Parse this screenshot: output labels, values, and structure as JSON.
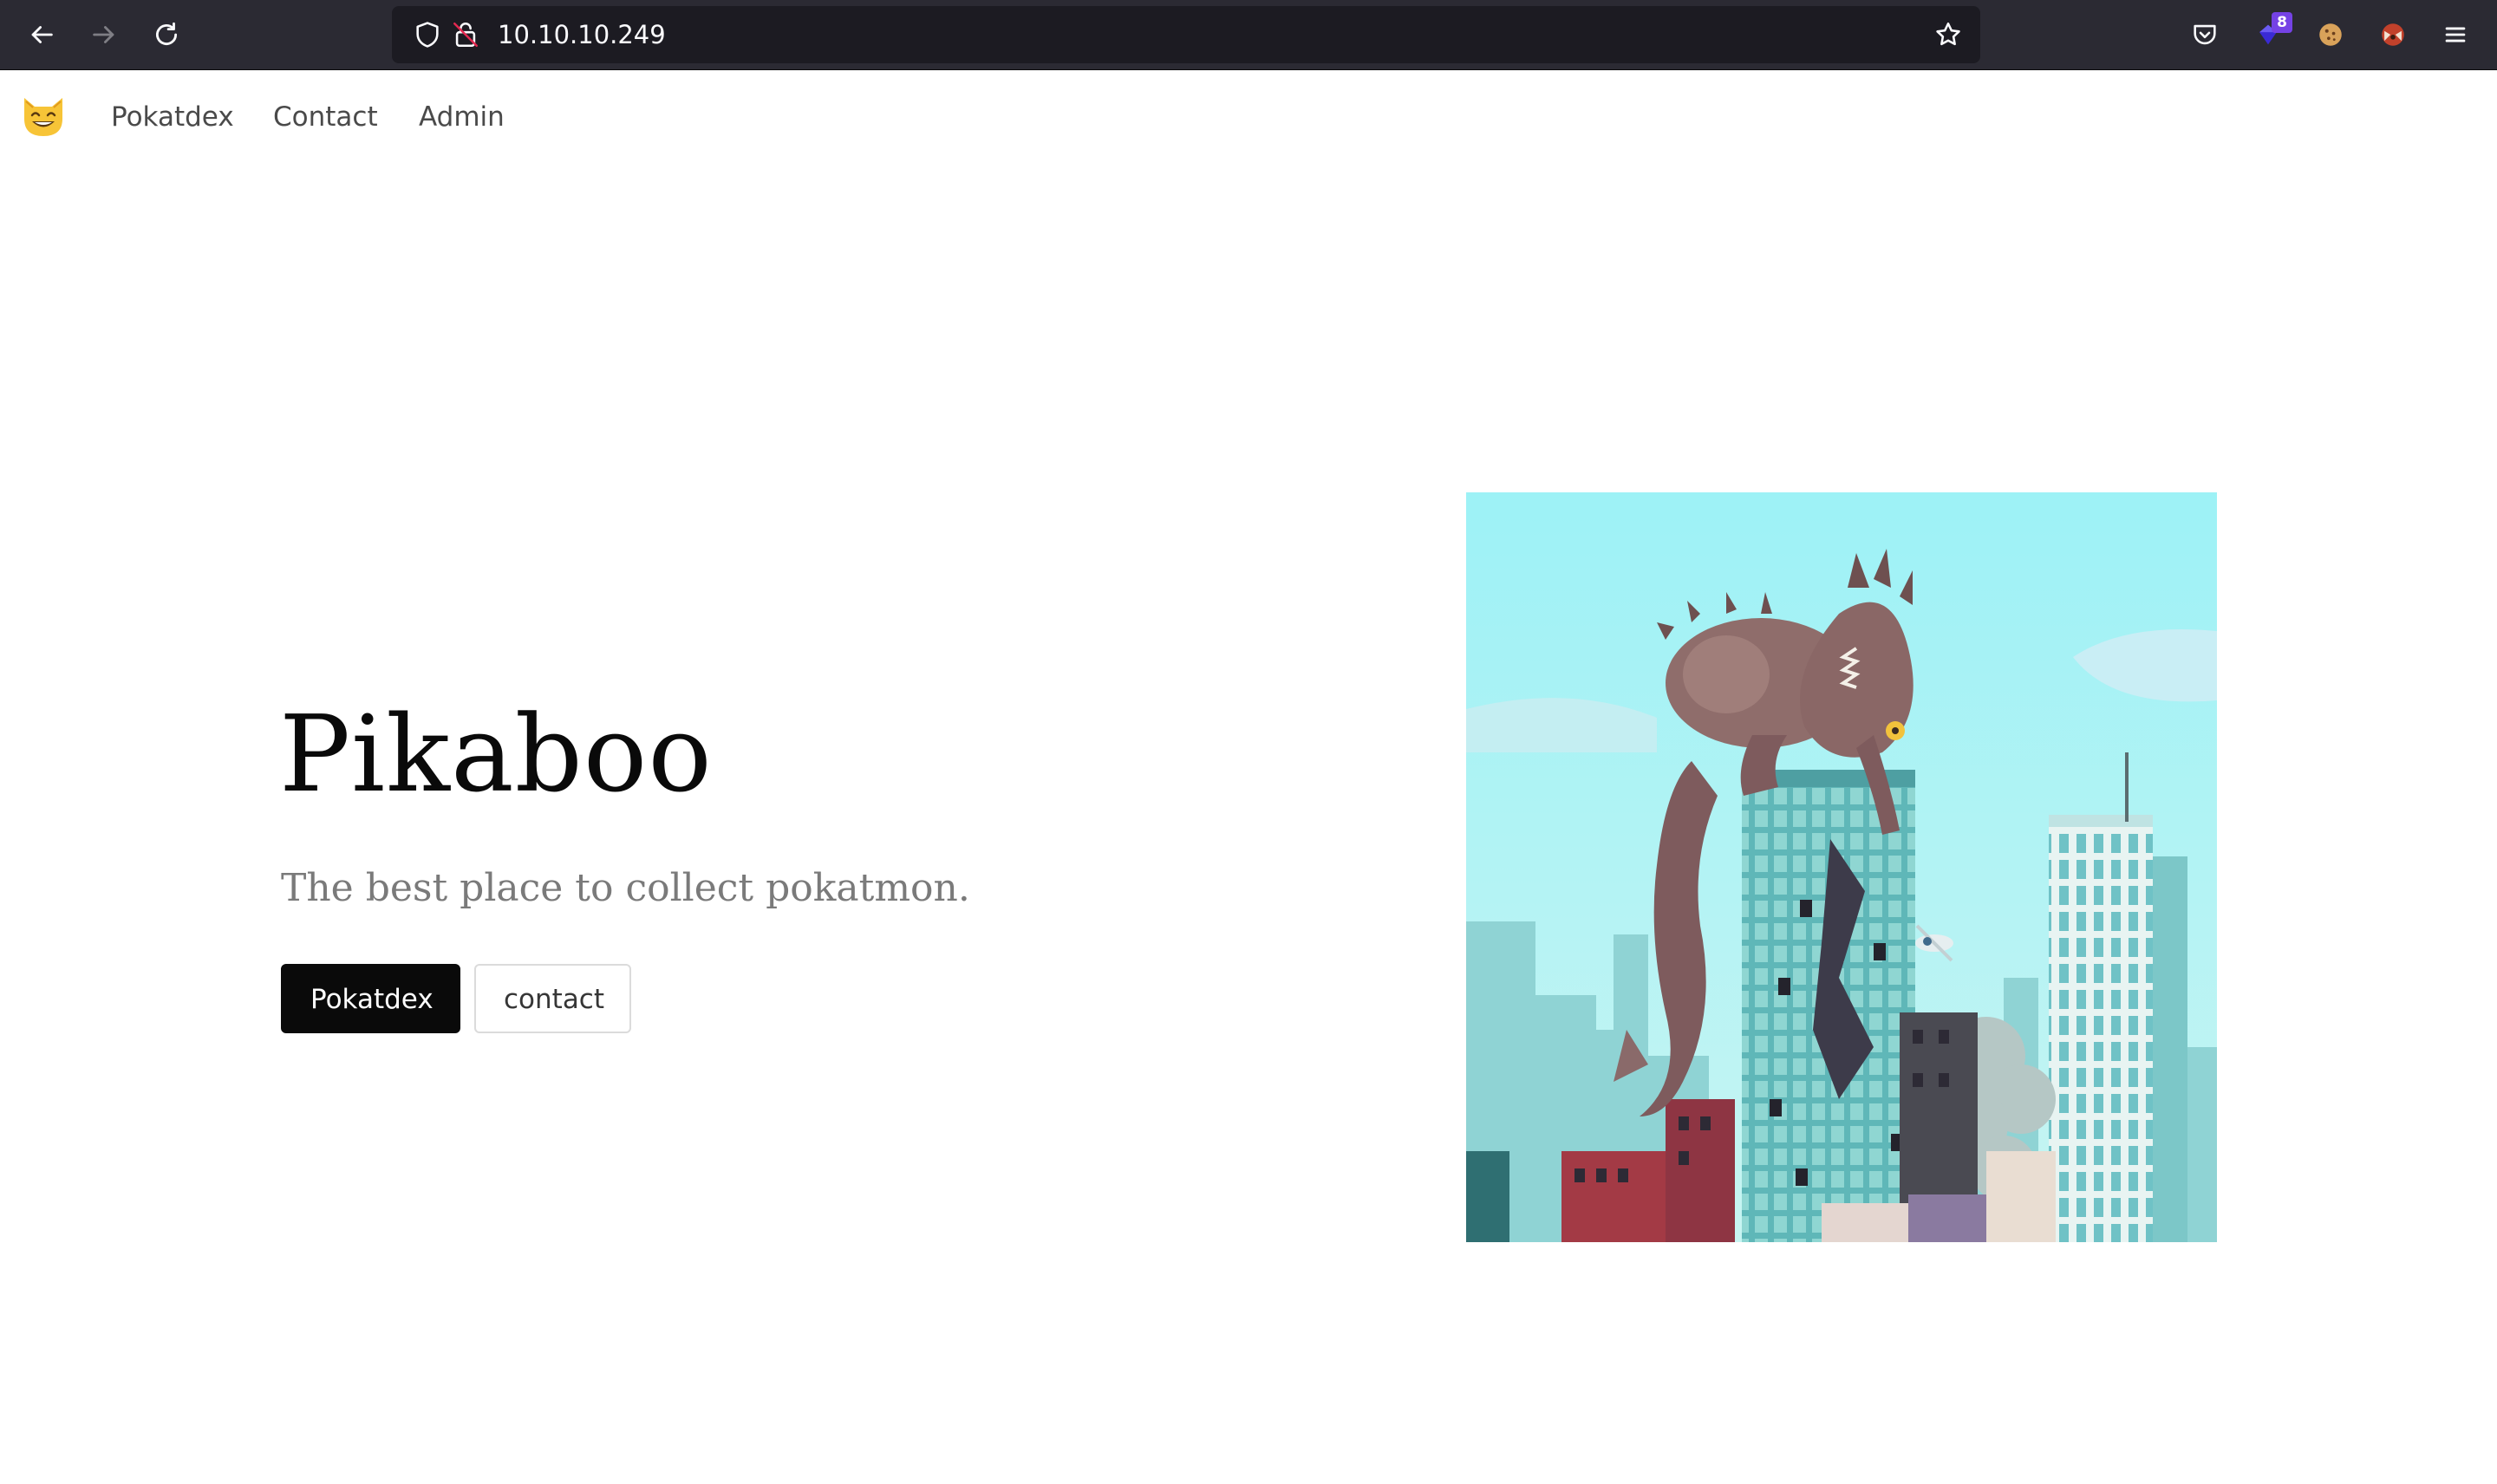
{
  "browser": {
    "url": "10.10.10.249",
    "extension_badge": "8",
    "icons": {
      "back": "back-arrow-icon",
      "forward": "forward-arrow-icon",
      "reload": "reload-icon",
      "tracking_protection": "shield-icon",
      "connection": "insecure-lock-icon",
      "bookmark": "star-icon",
      "pocket": "pocket-icon",
      "extension": "extension-icon",
      "cookie": "cookie-icon",
      "extension2": "fox-extension-icon",
      "menu": "hamburger-menu-icon"
    },
    "colors": {
      "toolbar": "#2b2a33",
      "urlbar": "#1c1b22",
      "badge": "#7542e5"
    }
  },
  "site": {
    "logo_icon": "grinning-cat-icon",
    "nav": {
      "items": [
        {
          "label": "Pokatdex"
        },
        {
          "label": "Contact"
        },
        {
          "label": "Admin"
        }
      ]
    },
    "hero": {
      "title": "Pikaboo",
      "subtitle": "The best place to collect pokatmon.",
      "primary_button": "Pokatdex",
      "secondary_button": "contact",
      "image_subject": "monster-on-skyscraper-illustration"
    },
    "colors": {
      "primary_button_bg": "#0a0a0a",
      "subtitle_text": "#7a7a7a",
      "sky": "#9cecf2",
      "building_teal": "#5fb7b8",
      "monster": "#8a6a6a"
    }
  }
}
